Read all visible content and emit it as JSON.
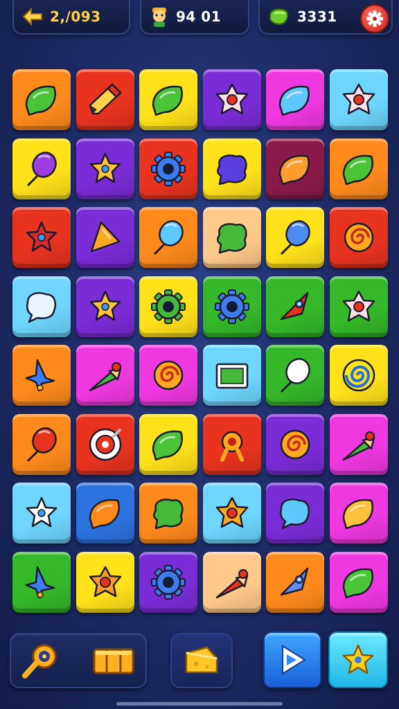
{
  "hud": {
    "left_value": "2,/093",
    "mid_value": "94 01",
    "right_value": "3331",
    "left_icon": "back-arrow-icon",
    "mid_icon": "character-avatar-icon",
    "right_icon": "green-gem-icon",
    "settings_icon": "gear-icon"
  },
  "colors": {
    "orange": "#ff8a1c",
    "red": "#e8331f",
    "yellow": "#ffe21a",
    "purple": "#7a2cd6",
    "magenta": "#f038e0",
    "cyan": "#6fd6ff",
    "blue": "#2c73e0",
    "green": "#35b82a",
    "peach": "#ffc98a",
    "maroon": "#8a1a4a"
  },
  "board": {
    "columns": 6,
    "rows": 8,
    "tiles": [
      {
        "bg": "orange",
        "icon": "leaf",
        "fg": "#4cc43a"
      },
      {
        "bg": "red",
        "icon": "pencil",
        "fg": "#ffd34a"
      },
      {
        "bg": "yellow",
        "icon": "leaf",
        "fg": "#4cc43a"
      },
      {
        "bg": "purple",
        "icon": "flower",
        "fg": "#ffe0e6"
      },
      {
        "bg": "magenta",
        "icon": "leaf",
        "fg": "#5ec8ff"
      },
      {
        "bg": "cyan",
        "icon": "flower",
        "fg": "#ffe0e6"
      },
      {
        "bg": "yellow",
        "icon": "balloon",
        "fg": "#9a3ee0"
      },
      {
        "bg": "purple",
        "icon": "star",
        "fg": "#ffc23a"
      },
      {
        "bg": "red",
        "icon": "gear",
        "fg": "#3c7ef2"
      },
      {
        "bg": "yellow",
        "icon": "blob",
        "fg": "#5a3ee0"
      },
      {
        "bg": "maroon",
        "icon": "leaf",
        "fg": "#ff9c2e"
      },
      {
        "bg": "orange",
        "icon": "leaf",
        "fg": "#4cc43a"
      },
      {
        "bg": "red",
        "icon": "star",
        "fg": "#d82a2a"
      },
      {
        "bg": "purple",
        "icon": "triangle",
        "fg": "#ffa820"
      },
      {
        "bg": "orange",
        "icon": "balloon",
        "fg": "#5ec8ff"
      },
      {
        "bg": "peach",
        "icon": "blob",
        "fg": "#47b93a"
      },
      {
        "bg": "yellow",
        "icon": "balloon",
        "fg": "#4d8bf2"
      },
      {
        "bg": "red",
        "icon": "swirl",
        "fg": "#ffa820"
      },
      {
        "bg": "cyan",
        "icon": "bubble",
        "fg": "#e8f6ff"
      },
      {
        "bg": "purple",
        "icon": "star",
        "fg": "#ffc23a"
      },
      {
        "bg": "yellow",
        "icon": "gear",
        "fg": "#47b93a"
      },
      {
        "bg": "green",
        "icon": "gear",
        "fg": "#3c7ef2"
      },
      {
        "bg": "green",
        "icon": "rocket",
        "fg": "#e8331f"
      },
      {
        "bg": "green",
        "icon": "flower",
        "fg": "#ffe0e6"
      },
      {
        "bg": "orange",
        "icon": "arrow",
        "fg": "#3c7ef2"
      },
      {
        "bg": "magenta",
        "icon": "cone",
        "fg": "#47b93a"
      },
      {
        "bg": "magenta",
        "icon": "swirl",
        "fg": "#ffa820"
      },
      {
        "bg": "cyan",
        "icon": "frame",
        "fg": "#47b93a"
      },
      {
        "bg": "green",
        "icon": "balloon",
        "fg": "#ffffff"
      },
      {
        "bg": "yellow",
        "icon": "spiral",
        "fg": "#1f6fe0"
      },
      {
        "bg": "orange",
        "icon": "balloon",
        "fg": "#e8331f"
      },
      {
        "bg": "red",
        "icon": "target",
        "fg": "#ffffff"
      },
      {
        "bg": "yellow",
        "icon": "leaf",
        "fg": "#4cc43a"
      },
      {
        "bg": "red",
        "icon": "knot",
        "fg": "#ffa820"
      },
      {
        "bg": "purple",
        "icon": "swirl",
        "fg": "#ffa820"
      },
      {
        "bg": "magenta",
        "icon": "cone",
        "fg": "#47b93a"
      },
      {
        "bg": "cyan",
        "icon": "star",
        "fg": "#ffffff"
      },
      {
        "bg": "blue",
        "icon": "leaf",
        "fg": "#ff8a1c"
      },
      {
        "bg": "orange",
        "icon": "blob",
        "fg": "#47b93a"
      },
      {
        "bg": "cyan",
        "icon": "flower",
        "fg": "#ffa820"
      },
      {
        "bg": "purple",
        "icon": "bubble",
        "fg": "#5ec8ff"
      },
      {
        "bg": "magenta",
        "icon": "leaf",
        "fg": "#ffc23a"
      },
      {
        "bg": "green",
        "icon": "arrow",
        "fg": "#3c7ef2"
      },
      {
        "bg": "yellow",
        "icon": "flower",
        "fg": "#ff9c2e"
      },
      {
        "bg": "purple",
        "icon": "gear",
        "fg": "#3c7ef2"
      },
      {
        "bg": "peach",
        "icon": "cone",
        "fg": "#e8331f"
      },
      {
        "bg": "orange",
        "icon": "rocket",
        "fg": "#5e8cf2"
      },
      {
        "bg": "magenta",
        "icon": "leaf",
        "fg": "#4cc43a"
      }
    ]
  },
  "bottom_bar": {
    "booster_left_icon": "magnifier-icon",
    "booster_right_icon": "treasure-chest-icon",
    "hammer_icon": "cheese-icon",
    "play_icon": "play-icon",
    "star_icon": "star-icon"
  }
}
